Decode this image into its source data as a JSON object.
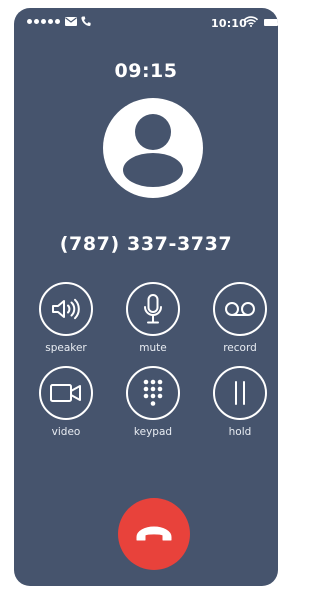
{
  "status_bar": {
    "time": "10:10",
    "icons": [
      "signal-dots-icon",
      "mail-icon",
      "phone-icon",
      "wifi-icon",
      "battery-icon"
    ]
  },
  "call": {
    "timer": "09:15",
    "number": "(787) 337-3737"
  },
  "controls": [
    {
      "label": "speaker",
      "icon": "speaker-icon"
    },
    {
      "label": "mute",
      "icon": "microphone-icon"
    },
    {
      "label": "record",
      "icon": "voicemail-icon"
    },
    {
      "label": "video",
      "icon": "video-camera-icon"
    },
    {
      "label": "keypad",
      "icon": "keypad-icon"
    },
    {
      "label": "hold",
      "icon": "pause-icon"
    }
  ],
  "colors": {
    "background": "#46546d",
    "end_call": "#e8423b",
    "foreground": "#ffffff"
  }
}
